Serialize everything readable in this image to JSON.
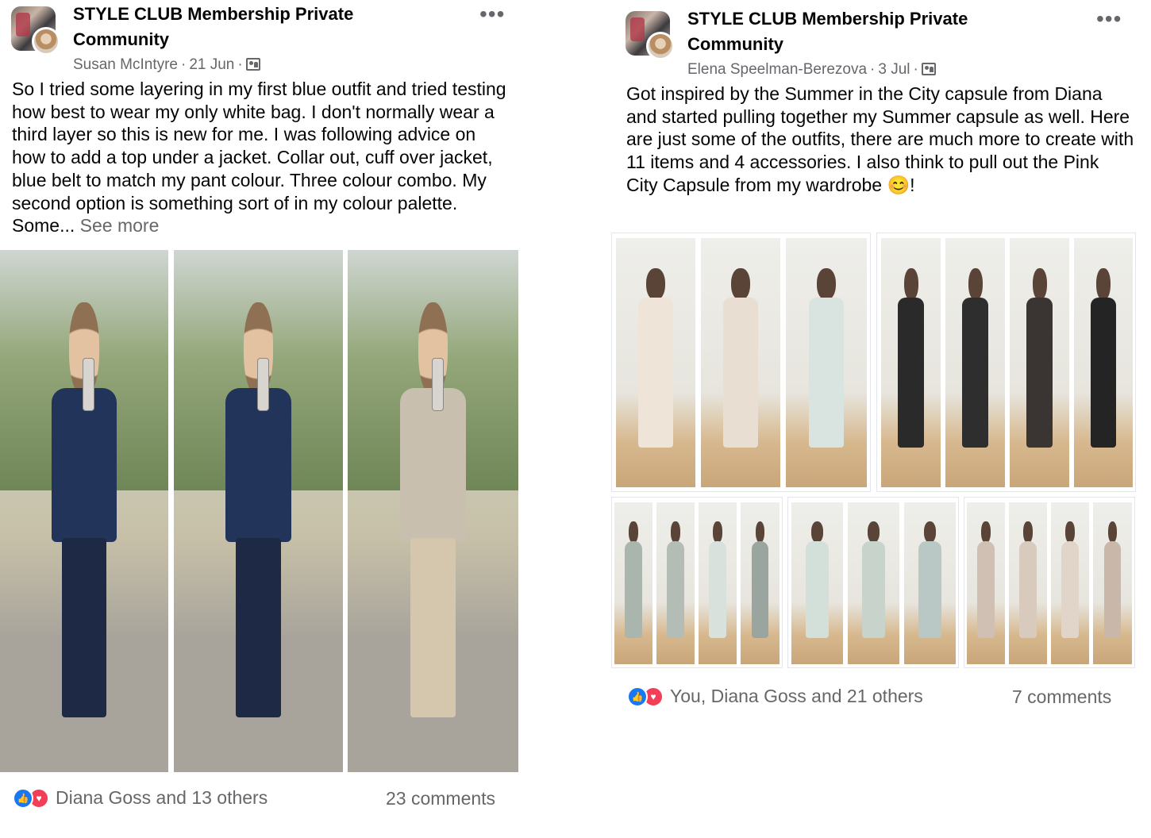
{
  "posts": [
    {
      "group_name": "STYLE CLUB Membership Private Community",
      "author": "Susan McIntyre",
      "date": "21 Jun",
      "separator": "·",
      "more_label": "•••",
      "text": "So I tried some layering in my first blue outfit and tried testing how best to wear my only white bag. I don't normally wear a third layer so this is new for me. I was following advice on how to add a top under a jacket. Collar out, cuff over jacket, blue belt to match my pant colour. Three colour combo. My second option is something sort of in my colour palette. Some...",
      "see_more": "See more",
      "photos": [
        {
          "label": "outfit-1-navy-blazer"
        },
        {
          "label": "outfit-2-navy-blazer"
        },
        {
          "label": "outfit-3-beige-blazer"
        }
      ],
      "reactions": "Diana Goss and 13 others",
      "comments": "23 comments",
      "reaction_icons": [
        "like-icon",
        "love-icon"
      ]
    },
    {
      "group_name": "STYLE CLUB Membership Private Community",
      "author": "Elena Speelman-Berezova",
      "date": "3 Jul",
      "separator": "·",
      "more_label": "•••",
      "text": "Got inspired by the Summer in the City capsule from Diana and started pulling together my Summer capsule as well. Here are just some of the outfits, there are much more to create with 11 items and 4 accessories. I also think to pull out the Pink City Capsule from my wardrobe 😊!",
      "reactions": "You, Diana Goss and 21 others",
      "comments": "7 comments",
      "reaction_icons": [
        "like-icon",
        "love-icon"
      ]
    }
  ],
  "colors": {
    "text_primary": "#050505",
    "text_secondary": "#65676b",
    "like_blue": "#1877f2",
    "love_red": "#f33e58"
  }
}
